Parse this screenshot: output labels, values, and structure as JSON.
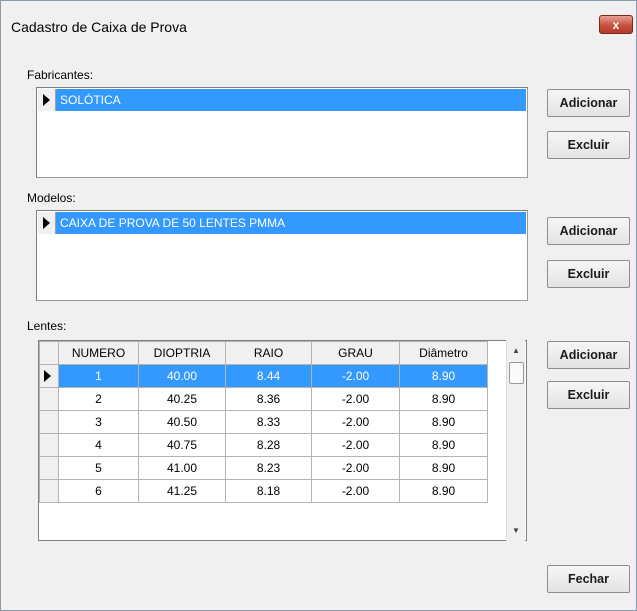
{
  "window": {
    "title": "Cadastro de Caixa de Prova",
    "close_glyph": "x"
  },
  "fabricantes": {
    "label": "Fabricantes:",
    "items": [
      "SOLÓTICA"
    ],
    "add_label": "Adicionar",
    "delete_label": "Excluir"
  },
  "modelos": {
    "label": "Modelos:",
    "items": [
      "CAIXA DE PROVA DE 50 LENTES PMMA"
    ],
    "add_label": "Adicionar",
    "delete_label": "Excluir"
  },
  "lentes": {
    "label": "Lentes:",
    "columns": [
      "NUMERO",
      "DIOPTRIA",
      "RAIO",
      "GRAU",
      "Diâmetro"
    ],
    "rows": [
      [
        "1",
        "40.00",
        "8.44",
        "-2.00",
        "8.90"
      ],
      [
        "2",
        "40.25",
        "8.36",
        "-2.00",
        "8.90"
      ],
      [
        "3",
        "40.50",
        "8.33",
        "-2.00",
        "8.90"
      ],
      [
        "4",
        "40.75",
        "8.28",
        "-2.00",
        "8.90"
      ],
      [
        "5",
        "41.00",
        "8.23",
        "-2.00",
        "8.90"
      ],
      [
        "6",
        "41.25",
        "8.18",
        "-2.00",
        "8.90"
      ]
    ],
    "selected_row": 0,
    "add_label": "Adicionar",
    "delete_label": "Excluir"
  },
  "footer": {
    "close_label": "Fechar"
  },
  "colors": {
    "selection": "#3399ff",
    "background": "#f0f0f0"
  }
}
